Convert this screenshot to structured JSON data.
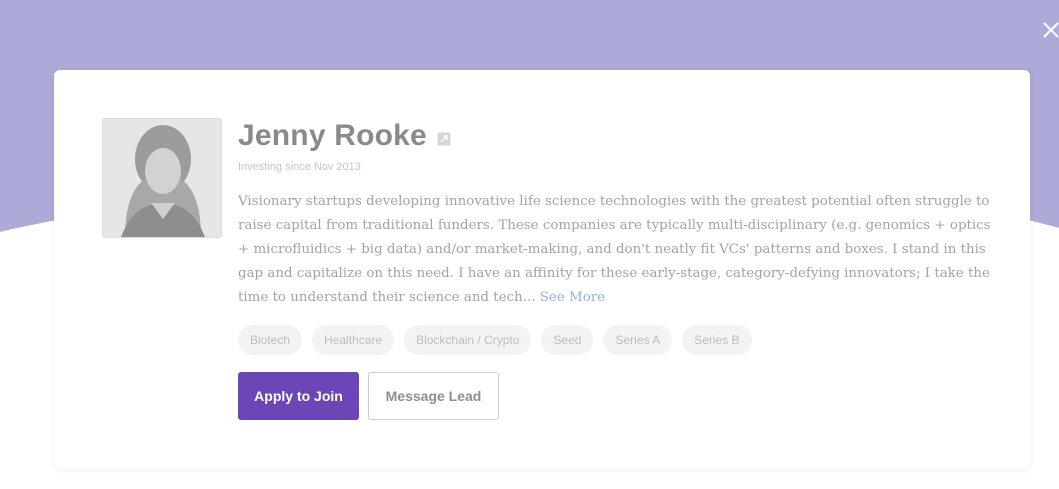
{
  "colors": {
    "header_bg": "#aeaad8",
    "primary_button": "#6a46b6",
    "link": "#8db2e6"
  },
  "modal": {
    "close_icon": "close-icon"
  },
  "profile": {
    "name": "Jenny Rooke",
    "external_link_icon": "external-link-icon",
    "investing_since": "Investing since Nov 2013",
    "bio": "Visionary startups developing innovative life science technologies with the greatest potential often struggle to raise capital from traditional funders. These companies are typically multi-disciplinary (e.g. genomics + optics + microfluidics + big data) and/or market-making, and don't neatly fit VCs' patterns and boxes. I stand in this gap and capitalize on this need. I have an affinity for these early-stage, category-defying innovators; I take the time to understand their science and tech...",
    "see_more": "See More",
    "tags": [
      "Biotech",
      "Healthcare",
      "Blockchain / Crypto",
      "Seed",
      "Series A",
      "Series B"
    ]
  },
  "actions": {
    "apply_label": "Apply to Join",
    "message_label": "Message Lead"
  }
}
